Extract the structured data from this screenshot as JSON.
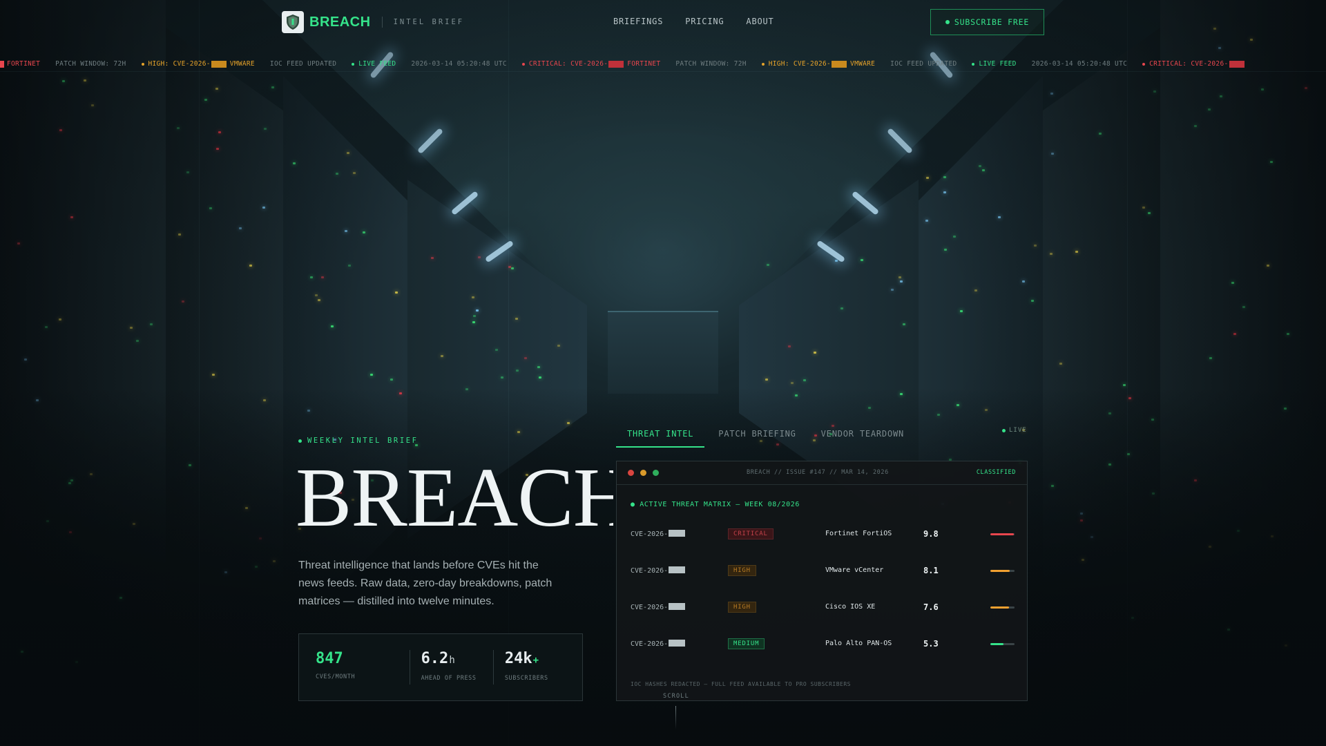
{
  "brand": {
    "name": "BREACH",
    "tagline": "INTEL BRIEF"
  },
  "nav": {
    "items": [
      "BRIEFINGS",
      "PRICING",
      "ABOUT"
    ],
    "cta_label": "SUBSCRIBE FREE"
  },
  "ticker": {
    "segments": [
      {
        "tone": "red",
        "parts": [
          "FORTINET"
        ]
      },
      {
        "tone": "gray",
        "parts": [
          "PATCH WINDOW: 72H"
        ]
      },
      {
        "tone": "amber",
        "parts": [
          "HIGH: CVE-2026-",
          "VMWARE"
        ]
      },
      {
        "tone": "gray",
        "parts": [
          "IOC FEED UPDATED"
        ]
      },
      {
        "tone": "green",
        "parts": [
          "LIVE FEED"
        ]
      },
      {
        "tone": "gray",
        "parts": [
          "2026-03-14 05:20:48 UTC"
        ]
      },
      {
        "tone": "red",
        "parts": [
          "CRITICAL: CVE-2026-",
          "FORTINET"
        ]
      },
      {
        "tone": "gray",
        "parts": [
          "PATCH WINDOW: 72H"
        ]
      },
      {
        "tone": "amber",
        "parts": [
          "HIGH: CVE-2026-",
          "VMWARE"
        ]
      },
      {
        "tone": "gray",
        "parts": [
          "IOC FEED UPDATED"
        ]
      },
      {
        "tone": "green",
        "parts": [
          "LIVE FEED"
        ]
      },
      {
        "tone": "gray",
        "parts": [
          "2026-03-14 05:20:48 UTC"
        ]
      },
      {
        "tone": "red",
        "parts": [
          "CRITICAL: CVE-2026-"
        ]
      }
    ]
  },
  "hero": {
    "eyebrow": "WEEKLY INTEL BRIEF",
    "title": "BREACH",
    "description": "Threat intelligence that lands before CVEs hit the news feeds. Raw data, zero-day breakdowns, patch matrices — distilled into twelve minutes.",
    "stats": [
      {
        "value": "847",
        "unit": "",
        "label": "CVES/MONTH"
      },
      {
        "value": "6.2",
        "unit": "h",
        "label": "AHEAD OF PRESS"
      },
      {
        "value": "24k",
        "unit": "+",
        "label": "SUBSCRIBERS"
      }
    ]
  },
  "tabs": {
    "items": [
      "THREAT INTEL",
      "PATCH BRIEFING",
      "VENDOR TEARDOWN"
    ],
    "active": "THREAT INTEL",
    "live_label": "LIVE"
  },
  "panel": {
    "path": "BREACH // ISSUE #147 // MAR 14, 2026",
    "classification": "CLASSIFIED",
    "matrix_title": "● ACTIVE THREAT MATRIX — WEEK 08/2026",
    "rows": [
      {
        "cve": "CVE-2026-",
        "severity": "CRITICAL",
        "vendor": "Fortinet FortiOS",
        "score": "9.8",
        "bar_fraction": 0.98,
        "bar_color": "#e8464e"
      },
      {
        "cve": "CVE-2026-",
        "severity": "HIGH",
        "vendor": "VMware vCenter",
        "score": "8.1",
        "bar_fraction": 0.81,
        "bar_color": "#f0a030"
      },
      {
        "cve": "CVE-2026-",
        "severity": "HIGH",
        "vendor": "Cisco IOS XE",
        "score": "7.6",
        "bar_fraction": 0.76,
        "bar_color": "#f0a030"
      },
      {
        "cve": "CVE-2026-",
        "severity": "MEDIUM",
        "vendor": "Palo Alto PAN-OS",
        "score": "5.3",
        "bar_fraction": 0.53,
        "bar_color": "#35e38a"
      }
    ],
    "footer": "IOC HASHES REDACTED — FULL FEED AVAILABLE TO PRO SUBSCRIBERS"
  },
  "scroll_label": "SCROLL",
  "colors": {
    "accent": "#35e38a",
    "critical": "#e8464e",
    "high": "#f0a030",
    "background": "#0b1418"
  }
}
